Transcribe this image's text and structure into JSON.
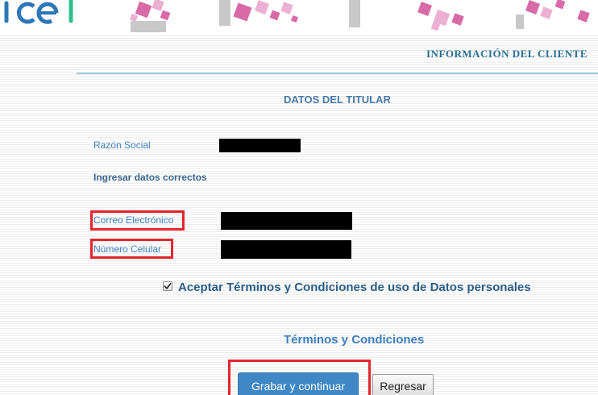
{
  "header": {
    "section_title": "INFORMACIÓN DEL CLIENTE",
    "brand_color": "#2a6f93"
  },
  "form": {
    "title": "DATOS DEL TITULAR",
    "fields": [
      {
        "label": "Razón Social",
        "value": "[redacted]"
      },
      {
        "label": "Correo Electrónico",
        "value": "[redacted]"
      },
      {
        "label": "Número Celular",
        "value": "[redacted]"
      }
    ],
    "notice": "Ingresar datos correctos",
    "terms_checkbox": {
      "label": "Aceptar Términos y Condiciones de uso de Datos personales",
      "checked": true
    },
    "terms_link": "Términos y Condiciones"
  },
  "actions": {
    "save_label": "Grabar y continuar",
    "back_label": "Regresar"
  },
  "colors": {
    "accent": "#3f88c5",
    "label": "#3f7fbf",
    "highlight": "#e3262d",
    "divider": "#9bcfd6"
  }
}
